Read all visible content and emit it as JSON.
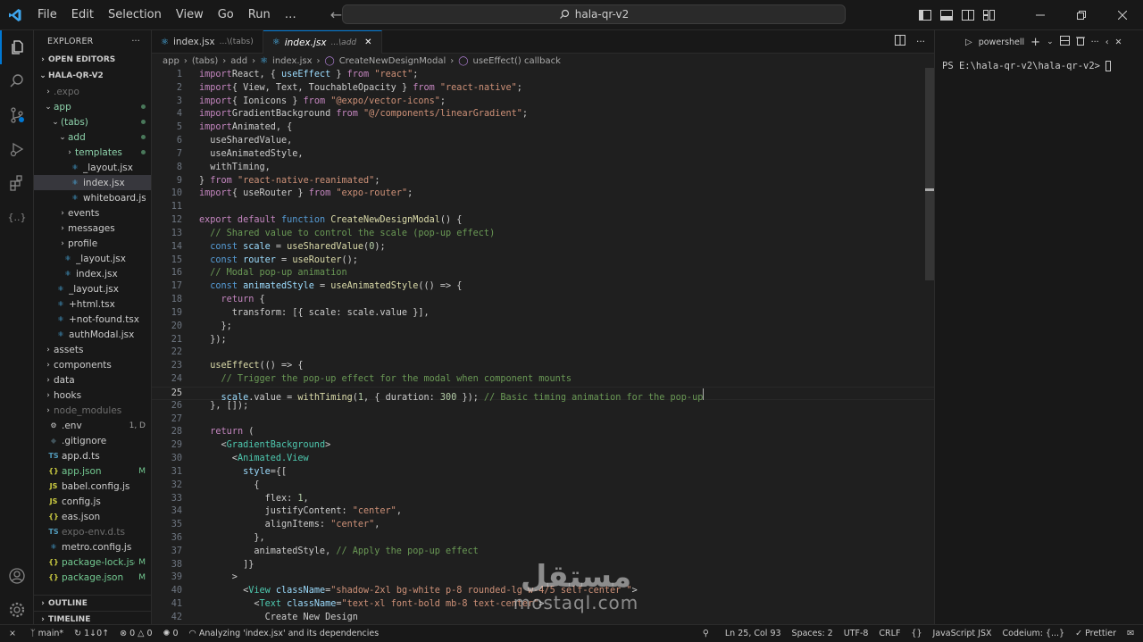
{
  "titlebar": {
    "menu": [
      "File",
      "Edit",
      "Selection",
      "View",
      "Go",
      "Run",
      "…"
    ],
    "search": "hala-qr-v2"
  },
  "colors": {
    "accent": "#0078d4",
    "background": "#1f1f1f",
    "chrome": "#181818",
    "modified": "#73c991"
  },
  "activity_bar": [
    "explorer-icon",
    "search-icon",
    "source-control-icon",
    "run-debug-icon",
    "extensions-icon",
    "json-icon",
    "account-icon",
    "settings-icon"
  ],
  "sidebar": {
    "title": "EXPLORER",
    "more": "···",
    "open_editors": "OPEN EDITORS",
    "project": "HALA-QR-V2",
    "tree": [
      {
        "label": ".expo",
        "indent": 1,
        "type": "folder",
        "open": false,
        "dim": true
      },
      {
        "label": "app",
        "indent": 1,
        "type": "folder",
        "open": true,
        "dot": true
      },
      {
        "label": "(tabs)",
        "indent": 2,
        "type": "folder",
        "open": true,
        "dot": true
      },
      {
        "label": "add",
        "indent": 3,
        "type": "folder",
        "open": true,
        "dot": true
      },
      {
        "label": "templates",
        "indent": 4,
        "type": "folder",
        "open": false,
        "dot": true
      },
      {
        "label": "_layout.jsx",
        "indent": 4,
        "type": "react"
      },
      {
        "label": "index.jsx",
        "indent": 4,
        "type": "react",
        "selected": true
      },
      {
        "label": "whiteboard.jsx",
        "indent": 4,
        "type": "react"
      },
      {
        "label": "events",
        "indent": 3,
        "type": "folder",
        "open": false
      },
      {
        "label": "messages",
        "indent": 3,
        "type": "folder",
        "open": false
      },
      {
        "label": "profile",
        "indent": 3,
        "type": "folder",
        "open": false
      },
      {
        "label": "_layout.jsx",
        "indent": 3,
        "type": "react"
      },
      {
        "label": "index.jsx",
        "indent": 3,
        "type": "react"
      },
      {
        "label": "_layout.jsx",
        "indent": 2,
        "type": "react"
      },
      {
        "label": "+html.tsx",
        "indent": 2,
        "type": "react"
      },
      {
        "label": "+not-found.tsx",
        "indent": 2,
        "type": "react"
      },
      {
        "label": "authModal.jsx",
        "indent": 2,
        "type": "react"
      },
      {
        "label": "assets",
        "indent": 1,
        "type": "folder",
        "open": false
      },
      {
        "label": "components",
        "indent": 1,
        "type": "folder",
        "open": false
      },
      {
        "label": "data",
        "indent": 1,
        "type": "folder",
        "open": false
      },
      {
        "label": "hooks",
        "indent": 1,
        "type": "folder",
        "open": false
      },
      {
        "label": "node_modules",
        "indent": 1,
        "type": "folder",
        "open": false,
        "dim": true
      },
      {
        "label": ".env",
        "indent": 1,
        "type": "env",
        "badge": "1, D"
      },
      {
        "label": ".gitignore",
        "indent": 1,
        "type": "git"
      },
      {
        "label": "app.d.ts",
        "indent": 1,
        "type": "ts"
      },
      {
        "label": "app.json",
        "indent": 1,
        "type": "json",
        "badge": "M",
        "modified": true
      },
      {
        "label": "babel.config.js",
        "indent": 1,
        "type": "js"
      },
      {
        "label": "config.js",
        "indent": 1,
        "type": "js"
      },
      {
        "label": "eas.json",
        "indent": 1,
        "type": "json"
      },
      {
        "label": "expo-env.d.ts",
        "indent": 1,
        "type": "ts",
        "dim": true
      },
      {
        "label": "metro.config.js",
        "indent": 1,
        "type": "react"
      },
      {
        "label": "package-lock.json",
        "indent": 1,
        "type": "json",
        "badge": "M",
        "modified": true
      },
      {
        "label": "package.json",
        "indent": 1,
        "type": "json",
        "badge": "M",
        "modified": true
      }
    ],
    "outline": "OUTLINE",
    "timeline": "TIMELINE"
  },
  "tabs": [
    {
      "label": "index.jsx",
      "desc": "...\\(tabs)",
      "active": false
    },
    {
      "label": "index.jsx",
      "desc": "...\\add",
      "active": true,
      "close": "✕"
    }
  ],
  "breadcrumbs": [
    "app",
    "(tabs)",
    "add",
    "index.jsx",
    "CreateNewDesignModal",
    "useEffect() callback"
  ],
  "editor": {
    "current_line": 25,
    "lines": [
      [
        [
          "kw",
          "import"
        ],
        [
          "",
          "React, { "
        ],
        [
          "va",
          "useEffect"
        ],
        [
          "",
          " } "
        ],
        [
          "kw",
          "from"
        ],
        [
          "",
          " "
        ],
        [
          "st",
          "\"react\""
        ],
        [
          "",
          ";"
        ]
      ],
      [
        [
          "kw",
          "import"
        ],
        [
          "",
          "{ View, Text, TouchableOpacity } "
        ],
        [
          "kw",
          "from"
        ],
        [
          "",
          " "
        ],
        [
          "st",
          "\"react-native\""
        ],
        [
          "",
          ";"
        ]
      ],
      [
        [
          "kw",
          "import"
        ],
        [
          "",
          "{ Ionicons } "
        ],
        [
          "kw",
          "from"
        ],
        [
          "",
          " "
        ],
        [
          "st",
          "\"@expo/vector-icons\""
        ],
        [
          "",
          ";"
        ]
      ],
      [
        [
          "kw",
          "import"
        ],
        [
          "",
          "GradientBackground "
        ],
        [
          "kw",
          "from"
        ],
        [
          "",
          " "
        ],
        [
          "st",
          "\"@/components/linearGradient\""
        ],
        [
          "",
          ";"
        ]
      ],
      [
        [
          "kw",
          "import"
        ],
        [
          "",
          "Animated, {"
        ]
      ],
      [
        [
          "",
          "  useSharedValue,"
        ]
      ],
      [
        [
          "",
          "  useAnimatedStyle,"
        ]
      ],
      [
        [
          "",
          "  withTiming,"
        ]
      ],
      [
        [
          "",
          "} "
        ],
        [
          "kw",
          "from"
        ],
        [
          "",
          " "
        ],
        [
          "st",
          "\"react-native-reanimated\""
        ],
        [
          "",
          ";"
        ]
      ],
      [
        [
          "kw",
          "import"
        ],
        [
          "",
          "{ useRouter } "
        ],
        [
          "kw",
          "from"
        ],
        [
          "",
          " "
        ],
        [
          "st",
          "\"expo-router\""
        ],
        [
          "",
          ";"
        ]
      ],
      [
        [
          "",
          ""
        ]
      ],
      [
        [
          "kw",
          "export default"
        ],
        [
          "",
          " "
        ],
        [
          "bl",
          "function"
        ],
        [
          "",
          " "
        ],
        [
          "fn",
          "CreateNewDesignModal"
        ],
        [
          "",
          "() {"
        ]
      ],
      [
        [
          "cm",
          "  // Shared value to control the scale (pop-up effect)"
        ]
      ],
      [
        [
          "",
          "  "
        ],
        [
          "bl",
          "const"
        ],
        [
          "",
          " "
        ],
        [
          "va",
          "scale"
        ],
        [
          "",
          " = "
        ],
        [
          "fn",
          "useSharedValue"
        ],
        [
          "",
          "("
        ],
        [
          "num",
          "0"
        ],
        [
          "",
          ");"
        ]
      ],
      [
        [
          "",
          "  "
        ],
        [
          "bl",
          "const"
        ],
        [
          "",
          " "
        ],
        [
          "va",
          "router"
        ],
        [
          "",
          " = "
        ],
        [
          "fn",
          "useRouter"
        ],
        [
          "",
          "();"
        ]
      ],
      [
        [
          "cm",
          "  // Modal pop-up animation"
        ]
      ],
      [
        [
          "",
          "  "
        ],
        [
          "bl",
          "const"
        ],
        [
          "",
          " "
        ],
        [
          "va",
          "animatedStyle"
        ],
        [
          "",
          " = "
        ],
        [
          "fn",
          "useAnimatedStyle"
        ],
        [
          "",
          "(() => {"
        ]
      ],
      [
        [
          "",
          "    "
        ],
        [
          "kw",
          "return"
        ],
        [
          "",
          " {"
        ]
      ],
      [
        [
          "",
          "      transform: [{ scale: scale.value }],"
        ]
      ],
      [
        [
          "",
          "    };"
        ]
      ],
      [
        [
          "",
          "  });"
        ]
      ],
      [
        [
          "",
          ""
        ]
      ],
      [
        [
          "",
          "  "
        ],
        [
          "fn",
          "useEffect"
        ],
        [
          "",
          "(() => {"
        ]
      ],
      [
        [
          "cm",
          "    // Trigger the pop-up effect for the modal when component mounts"
        ]
      ],
      [
        [
          "",
          "    "
        ],
        [
          "va",
          "scale"
        ],
        [
          "",
          ".value = "
        ],
        [
          "fn",
          "withTiming"
        ],
        [
          "",
          "("
        ],
        [
          "num",
          "1"
        ],
        [
          "",
          ", { duration: "
        ],
        [
          "num",
          "300"
        ],
        [
          "",
          " }); "
        ],
        [
          "cm",
          "// Basic timing animation for the pop-up"
        ]
      ],
      [
        [
          "",
          "  }, []);"
        ]
      ],
      [
        [
          "",
          ""
        ]
      ],
      [
        [
          "",
          "  "
        ],
        [
          "kw",
          "return"
        ],
        [
          "",
          " ("
        ]
      ],
      [
        [
          "",
          "    <"
        ],
        [
          "tg",
          "GradientBackground"
        ],
        [
          "",
          ">"
        ]
      ],
      [
        [
          "",
          "      <"
        ],
        [
          "tg",
          "Animated.View"
        ]
      ],
      [
        [
          "",
          "        "
        ],
        [
          "va",
          "style"
        ],
        [
          "",
          "={["
        ]
      ],
      [
        [
          "",
          "          {"
        ]
      ],
      [
        [
          "",
          "            flex: "
        ],
        [
          "num",
          "1"
        ],
        [
          "",
          ","
        ]
      ],
      [
        [
          "",
          "            justifyContent: "
        ],
        [
          "st",
          "\"center\""
        ],
        [
          "",
          ","
        ]
      ],
      [
        [
          "",
          "            alignItems: "
        ],
        [
          "st",
          "\"center\""
        ],
        [
          "",
          ","
        ]
      ],
      [
        [
          "",
          "          },"
        ]
      ],
      [
        [
          "",
          "          animatedStyle, "
        ],
        [
          "cm",
          "// Apply the pop-up effect"
        ]
      ],
      [
        [
          "",
          "        ]}"
        ]
      ],
      [
        [
          "",
          "      >"
        ]
      ],
      [
        [
          "",
          "        <"
        ],
        [
          "tg",
          "View"
        ],
        [
          "",
          " "
        ],
        [
          "va",
          "className"
        ],
        [
          "",
          "="
        ],
        [
          "st",
          "\"shadow-2xl bg-white p-8 rounded-lg w-4/5 self-center \""
        ],
        [
          "",
          ">"
        ]
      ],
      [
        [
          "",
          "          <"
        ],
        [
          "tg",
          "Text"
        ],
        [
          "",
          " "
        ],
        [
          "va",
          "className"
        ],
        [
          "",
          "="
        ],
        [
          "st",
          "\"text-xl font-bold mb-8 text-center\""
        ],
        [
          "",
          ">"
        ]
      ],
      [
        [
          "",
          "            Create New Design"
        ]
      ]
    ]
  },
  "terminal": {
    "shell": "powershell",
    "prompt": "PS E:\\hala-qr-v2\\hala-qr-v2> "
  },
  "statusbar": {
    "branch": "main*",
    "sync": "1↓0↑",
    "problems": "0",
    "warnings": "0",
    "ports": "0",
    "activity": "Analyzing 'index.jsx' and its dependencies",
    "position": "Ln 25, Col 93",
    "spaces": "Spaces: 2",
    "encoding": "UTF-8",
    "eol": "CRLF",
    "braces": "{}",
    "language": "JavaScript JSX",
    "codeium": "Codeium: {...}",
    "prettier": "Prettier"
  },
  "watermark": {
    "arabic": "مستقل",
    "latin": "mostaql.com"
  }
}
